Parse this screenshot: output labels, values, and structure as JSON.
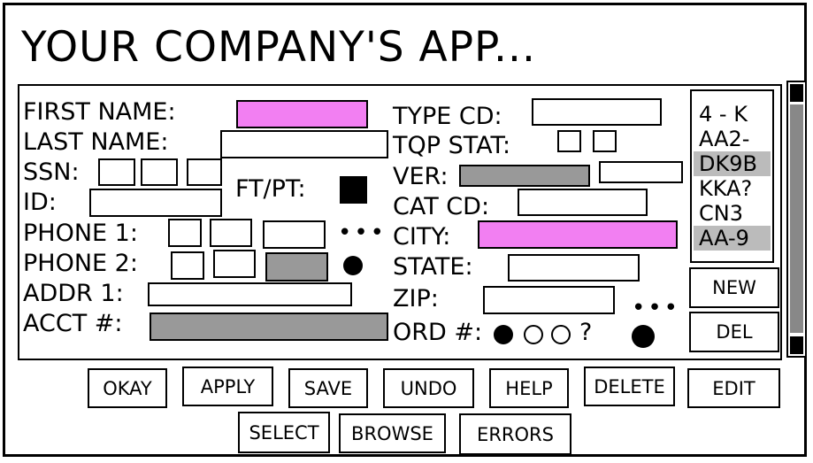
{
  "app": {
    "title": "YOUR COMPANY'S APP..."
  },
  "form": {
    "first_name_label": "FIRST NAME:",
    "last_name_label": "LAST NAME:",
    "ssn_label": "SSN:",
    "id_label": "ID:",
    "ftpt_label": "FT/PT:",
    "phone1_label": "PHONE 1:",
    "phone2_label": "PHONE 2:",
    "addr1_label": "ADDR 1:",
    "acct_label": "ACCT #:",
    "type_cd_label": "TYPE CD:",
    "tqp_stat_label": "TQP STAT:",
    "ver_label": "VER:",
    "cat_cd_label": "CAT CD:",
    "city_label": "CITY:",
    "state_label": "STATE:",
    "zip_label": "ZIP:",
    "ord_label": "ORD #:",
    "ord_question": "?",
    "ellipsis": "•••"
  },
  "list": {
    "items": [
      "4 - K",
      "AA2-",
      "DK9B",
      "KKA?",
      "CN3",
      "AA-9"
    ],
    "selected": [
      "DK9B",
      "AA-9"
    ]
  },
  "side_buttons": {
    "new": "NEW",
    "del": "DEL"
  },
  "buttons": {
    "okay": "OKAY",
    "apply": "APPLY",
    "save": "SAVE",
    "undo": "UNDO",
    "help": "HELP",
    "delete": "DELETE",
    "edit": "EDIT",
    "select": "SELECT",
    "browse": "BROWSE",
    "errors": "ERRORS"
  },
  "colors": {
    "required": "#f27ff2",
    "disabled": "#999999"
  }
}
